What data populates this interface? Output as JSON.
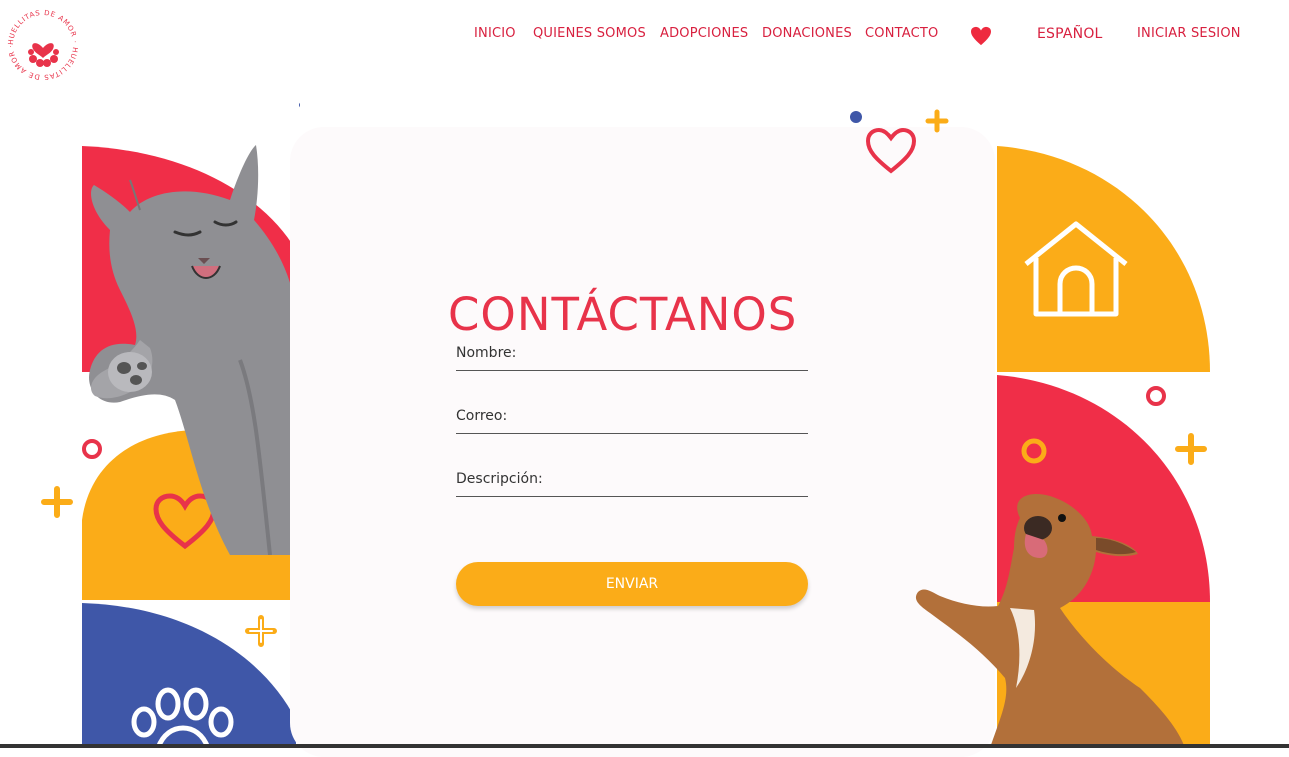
{
  "brand": {
    "logo_text": "HUELLITAS DE AMOR",
    "color_primary": "#e8334a",
    "color_accent": "#fbac18",
    "color_blue": "#3f57a8"
  },
  "nav": {
    "items": [
      {
        "label": "INICIO"
      },
      {
        "label": "QUIENES SOMOS"
      },
      {
        "label": "ADOPCIONES"
      },
      {
        "label": "DONACIONES"
      },
      {
        "label": "CONTACTO"
      }
    ],
    "favorites_icon": "heart-icon",
    "language": "ESPAÑOL",
    "login": "INICIAR SESION"
  },
  "contact": {
    "title": "CONTÁCTANOS",
    "fields": [
      {
        "label": "Nombre:",
        "value": ""
      },
      {
        "label": "Correo:",
        "value": ""
      },
      {
        "label": "Descripción:",
        "value": ""
      }
    ],
    "submit_label": "ENVIAR"
  },
  "illustrations": {
    "left_photo": "cat-photo",
    "right_photo": "dog-photo",
    "house_icon": "dog-house-icon",
    "paw_icon": "paw-icon"
  }
}
